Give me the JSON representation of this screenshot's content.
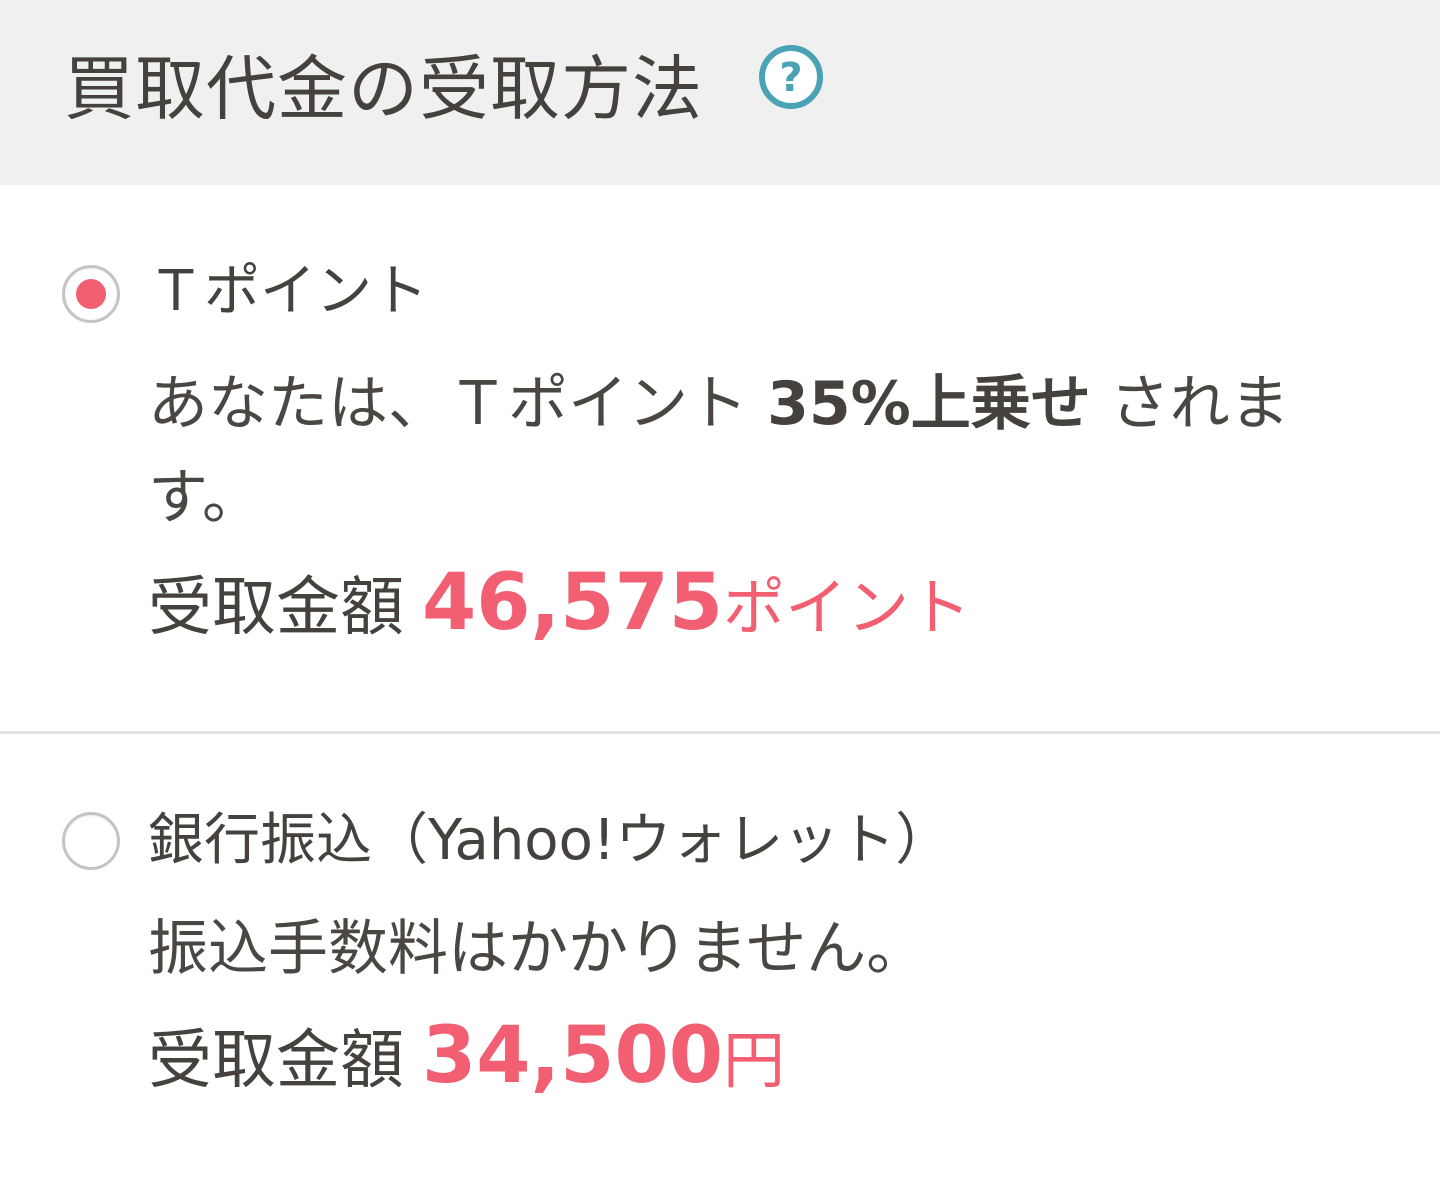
{
  "header": {
    "title": "買取代金の受取方法",
    "help_icon": "question-circle-icon",
    "help_icon_color": "#4aa3b5"
  },
  "options": [
    {
      "label": "Ｔポイント",
      "selected": true,
      "desc_before": "あなたは、Ｔポイント ",
      "desc_emphasis": "35%上乗せ",
      "desc_after": " されます。",
      "amount_label": "受取金額",
      "amount_value": "46,575",
      "amount_unit": "ポイント"
    },
    {
      "label": "銀行振込（Yahoo!ウォレット）",
      "selected": false,
      "desc": "振込手数料はかかりません。",
      "amount_label": "受取金額",
      "amount_value": "34,500",
      "amount_unit": "円"
    }
  ],
  "colors": {
    "accent": "#f25f72",
    "header_bg": "#f0f0f0",
    "text": "#45413c",
    "divider": "#e2e2e2"
  }
}
